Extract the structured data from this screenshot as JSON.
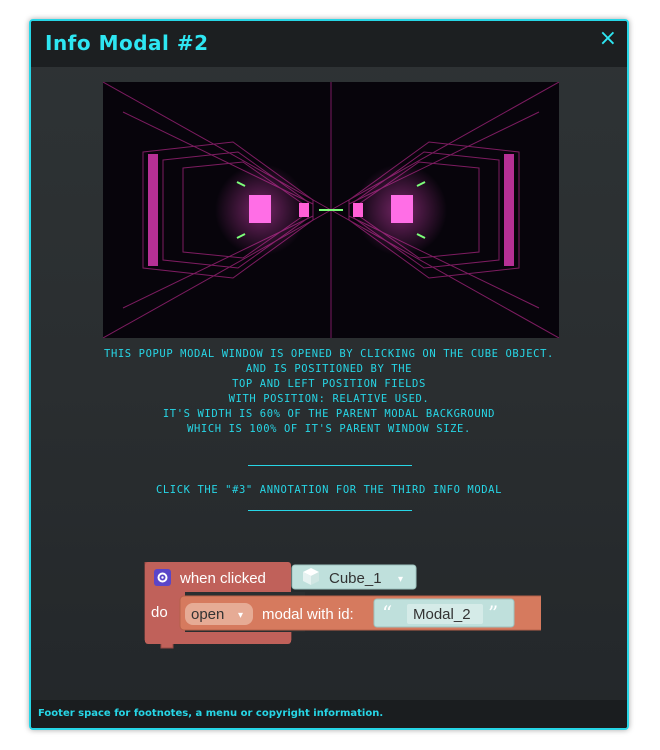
{
  "modal": {
    "title": "Info Modal #2",
    "close_icon": "×",
    "paragraph_lines": [
      "this popup modal window is opened by clicking on the cube object.",
      "and is positioned by the",
      "top and left position fields",
      "with position: relative used.",
      "it's width is 60% of the parent modal background",
      "which is 100% of it's parent window size."
    ],
    "call_to_action": "click the \"#3\" annotation for the third info modal",
    "footer": "Footer space for footnotes, a menu or copyright information."
  },
  "blocks": {
    "event_label": "when clicked",
    "event_target": "Cube_1",
    "do_label": "do",
    "action_dropdown": "open",
    "action_text": "modal with id:",
    "modal_id_value": "Modal_2",
    "open_quote": "“",
    "close_quote": "”",
    "dropdown_arrow": "▾"
  },
  "colors": {
    "accent": "#27d6e6",
    "event_block": "#c0615a",
    "action_block": "#d67a5e",
    "text_block": "#bfe0dc"
  }
}
